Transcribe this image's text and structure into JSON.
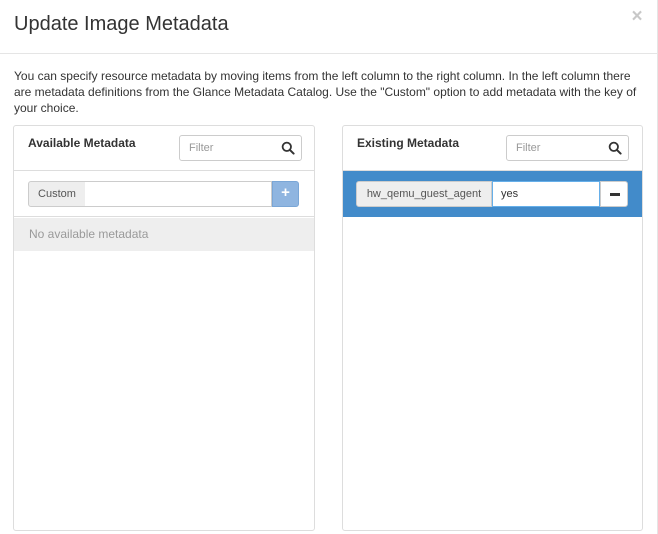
{
  "modal": {
    "title": "Update Image Metadata",
    "close_glyph": "×",
    "description": "You can specify resource metadata by moving items from the left column to the right column. In the left column there are metadata definitions from the Glance Metadata Catalog. Use the \"Custom\" option to add metadata with the key of your choice."
  },
  "available": {
    "title": "Available Metadata",
    "filter_placeholder": "Filter",
    "filter_icon": "search-icon",
    "custom_label": "Custom",
    "custom_value": "",
    "add_glyph": "+",
    "empty_message": "No available metadata"
  },
  "existing": {
    "title": "Existing Metadata",
    "filter_placeholder": "Filter",
    "filter_icon": "search-icon",
    "items": [
      {
        "key": "hw_qemu_guest_agent",
        "value": "yes"
      }
    ]
  },
  "colors": {
    "accent": "#428bca",
    "add_button": "#8fb5e0",
    "empty_row": "#eeeeee"
  }
}
